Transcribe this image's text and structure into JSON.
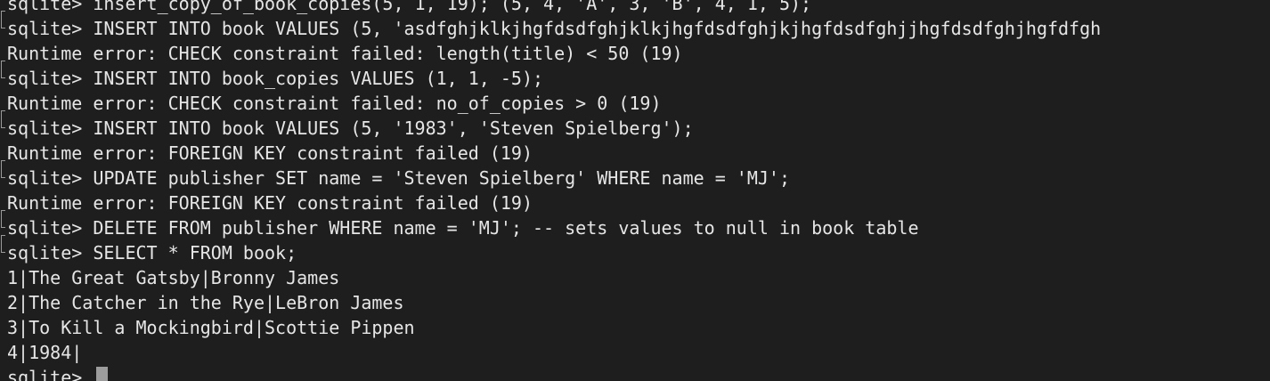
{
  "terminal": {
    "lines": [
      "sqlite> insert_copy_of_book_copies(5, 1, 19); (5, 4, 'A', 3, 'B', 4, 1, 5);",
      "sqlite> INSERT INTO book VALUES (5, 'asdfghjklkjhgfdsdfghjklkjhgfdsdfghjkjhgfdsdfghjjhgfdsdfghjhgfdfgh",
      "Runtime error: CHECK constraint failed: length(title) < 50 (19)",
      "sqlite> INSERT INTO book_copies VALUES (1, 1, -5);",
      "Runtime error: CHECK constraint failed: no_of_copies > 0 (19)",
      "sqlite> INSERT INTO book VALUES (5, '1983', 'Steven Spielberg');",
      "Runtime error: FOREIGN KEY constraint failed (19)",
      "sqlite> UPDATE publisher SET name = 'Steven Spielberg' WHERE name = 'MJ';",
      "Runtime error: FOREIGN KEY constraint failed (19)",
      "sqlite> DELETE FROM publisher WHERE name = 'MJ'; -- sets values to null in book table",
      "sqlite> SELECT * FROM book;",
      "1|The Great Gatsby|Bronny James",
      "2|The Catcher in the Rye|LeBron James",
      "3|To Kill a Mockingbird|Scottie Pippen",
      "4|1984|"
    ],
    "prompt": "sqlite> ",
    "colors": {
      "background": "#1e1e1e",
      "text": "#e6e6e6",
      "cursor": "#9c9c9c"
    }
  }
}
